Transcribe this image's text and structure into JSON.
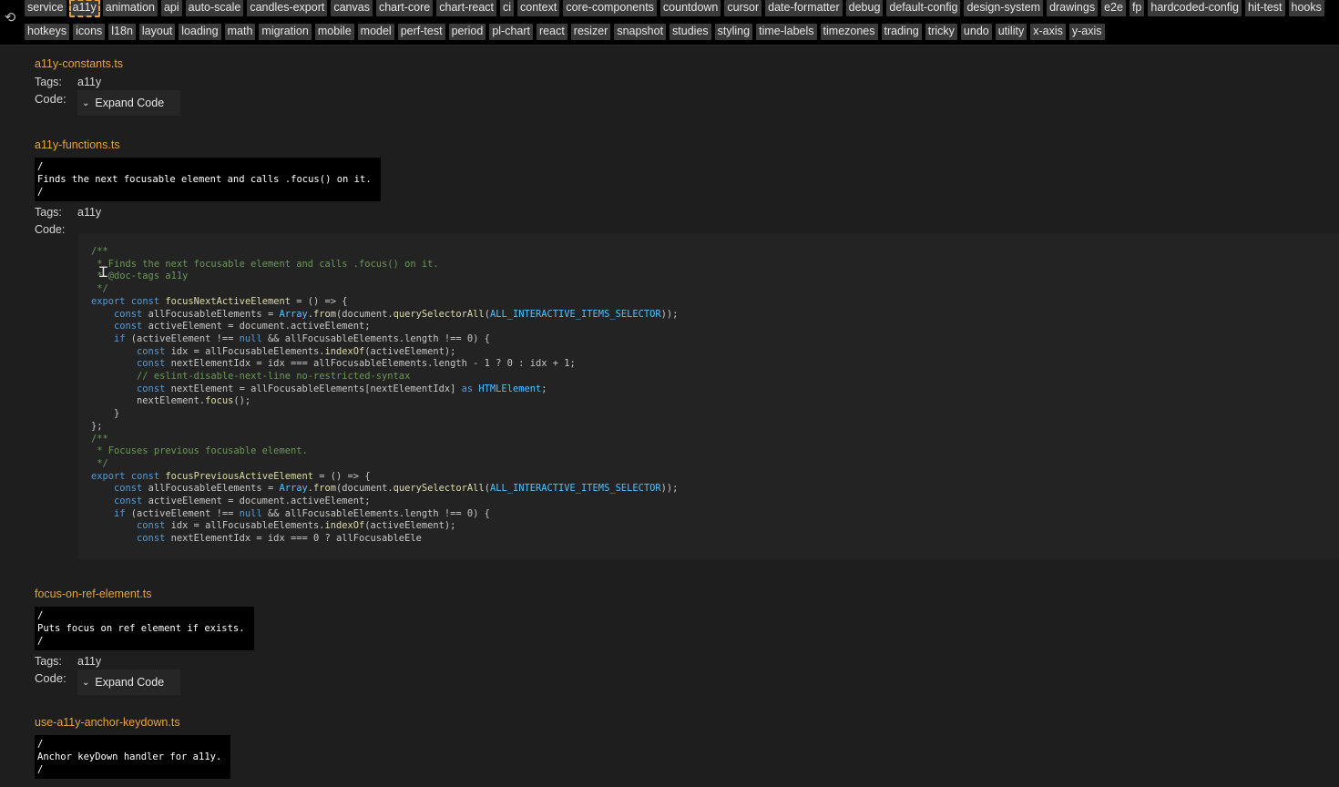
{
  "topbar": {
    "row1": [
      "service",
      "a11y",
      "animation",
      "api",
      "auto-scale",
      "candles-export",
      "canvas",
      "chart-core",
      "chart-react",
      "ci",
      "context",
      "core-components",
      "countdown",
      "cursor",
      "date-formatter",
      "debug",
      "default-config",
      "design-system",
      "drawings",
      "e2e",
      "fp",
      "hardcoded-config",
      "hit-test",
      "hooks"
    ],
    "row2": [
      "hotkeys",
      "icons",
      "l18n",
      "layout",
      "loading",
      "math",
      "migration",
      "mobile",
      "model",
      "perf-test",
      "period",
      "pl-chart",
      "react",
      "resizer",
      "snapshot",
      "studies",
      "styling",
      "time-labels",
      "timezones",
      "trading",
      "tricky",
      "undo",
      "utility",
      "x-axis",
      "y-axis"
    ],
    "selected": "a11y"
  },
  "labels": {
    "tags": "Tags:",
    "code": "Code:",
    "expand": "Expand Code"
  },
  "files": [
    {
      "name": "a11y-constants.ts",
      "tag": "a11y"
    },
    {
      "name": "a11y-functions.ts",
      "comment": "/\nFinds the next focusable element and calls .focus() on it.\n/",
      "tag": "a11y"
    },
    {
      "name": "focus-on-ref-element.ts",
      "comment": "/\nPuts focus on ref element if exists.\n/",
      "tag": "a11y"
    },
    {
      "name": "use-a11y-anchor-keydown.ts",
      "comment": "/\nAnchor keyDown handler for a11y.\n/"
    }
  ],
  "code": [
    "/**",
    " * Finds the next focusable element and calls .focus() on it.",
    " * @doc-tags a11y",
    " */",
    "export const focusNextActiveElement = () => {",
    "    const allFocusableElements = Array.from(document.querySelectorAll(ALL_INTERACTIVE_ITEMS_SELECTOR));",
    "    const activeElement = document.activeElement;",
    "    if (activeElement !== null && allFocusableElements.length !== 0) {",
    "        const idx = allFocusableElements.indexOf(activeElement);",
    "        const nextElementIdx = idx === allFocusableElements.length - 1 ? 0 : idx + 1;",
    "        // eslint-disable-next-line no-restricted-syntax",
    "        const nextElement = allFocusableElements[nextElementIdx] as HTMLElement;",
    "        nextElement.focus();",
    "    }",
    "};",
    "/**",
    " * Focuses previous focusable element.",
    " */",
    "export const focusPreviousActiveElement = () => {",
    "    const allFocusableElements = Array.from(document.querySelectorAll(ALL_INTERACTIVE_ITEMS_SELECTOR));",
    "    const activeElement = document.activeElement;",
    "    if (activeElement !== null && allFocusableElements.length !== 0) {",
    "        const idx = allFocusableElements.indexOf(activeElement);",
    "        const nextElementIdx = idx === 0 ? allFocusableEle"
  ],
  "icons": {
    "refresh": "refresh-icon",
    "chevron": "chevron-down-icon",
    "cursor": "text-cursor-icon"
  }
}
